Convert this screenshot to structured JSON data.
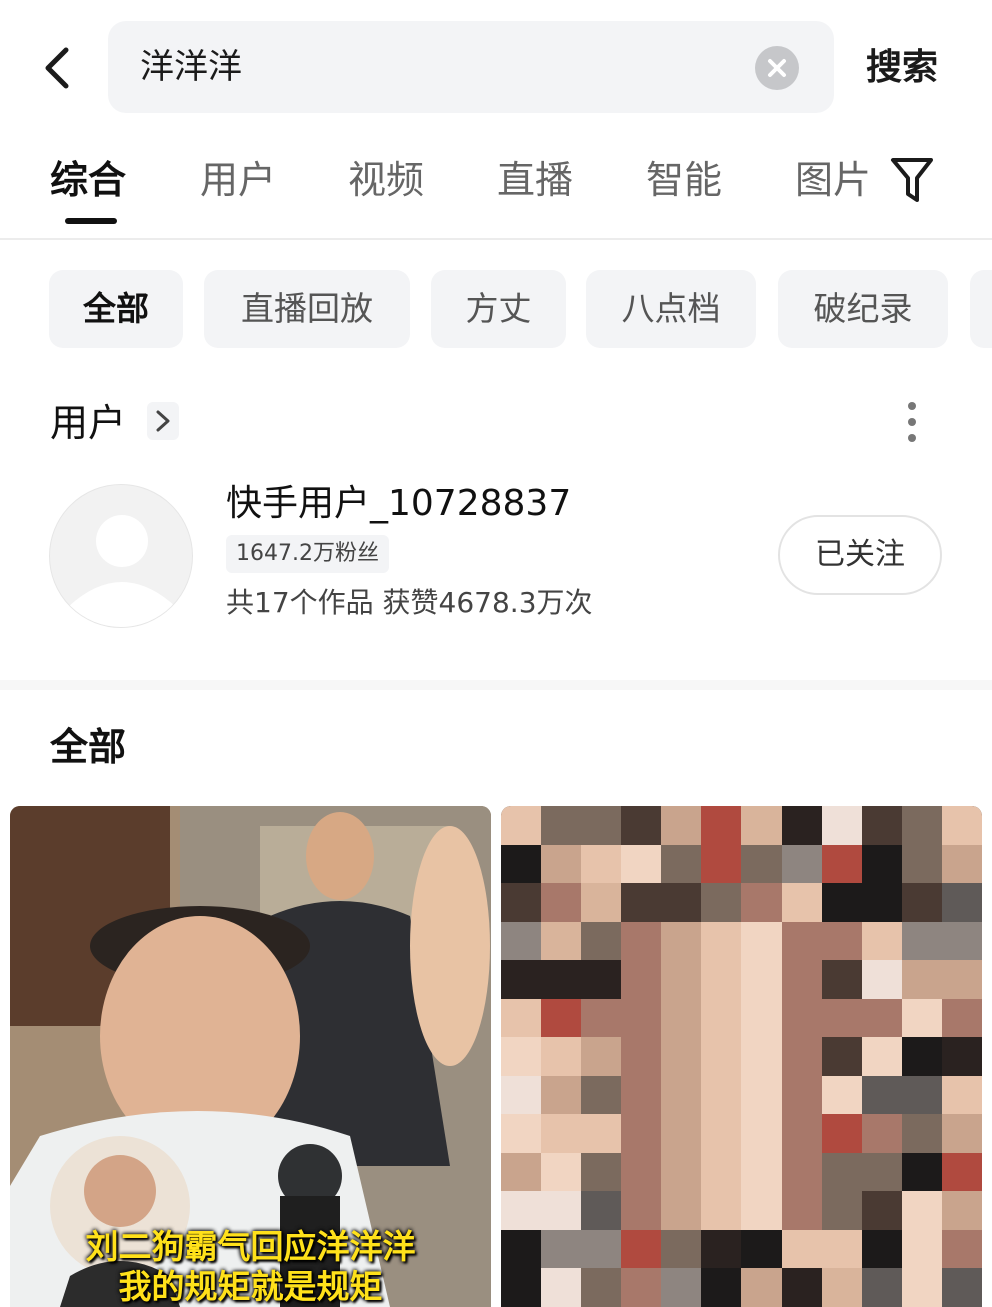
{
  "search": {
    "query": "洋洋洋",
    "submit_label": "搜索"
  },
  "tabs": [
    {
      "label": "综合",
      "active": true
    },
    {
      "label": "用户",
      "active": false
    },
    {
      "label": "视频",
      "active": false
    },
    {
      "label": "直播",
      "active": false
    },
    {
      "label": "智能",
      "active": false
    },
    {
      "label": "图片",
      "active": false
    }
  ],
  "chips": [
    {
      "label": "全部",
      "active": true
    },
    {
      "label": "直播回放",
      "active": false
    },
    {
      "label": "方丈",
      "active": false
    },
    {
      "label": "八点档",
      "active": false
    },
    {
      "label": "破纪录",
      "active": false
    }
  ],
  "user_section": {
    "title": "用户",
    "user": {
      "name": "快手用户_10728837",
      "fans": "1647.2万粉丝",
      "stats": "共17个作品 获赞4678.3万次",
      "follow_label": "已关注"
    }
  },
  "results_section": {
    "title": "全部",
    "cards": [
      {
        "caption": "刘二狗霸气回应洋洋洋\n我的规矩就是规矩"
      },
      {
        "caption": ""
      }
    ]
  },
  "icons": {
    "back": "chevron-left-icon",
    "clear": "clear-icon",
    "filter": "filter-icon",
    "more": "more-vertical-icon",
    "section_chevron": "chevron-right-icon",
    "avatar": "default-avatar-icon"
  },
  "colors": {
    "text_primary": "#111111",
    "text_secondary": "#666666",
    "chip_bg": "#f3f4f6",
    "caption": "#ffe11a"
  }
}
